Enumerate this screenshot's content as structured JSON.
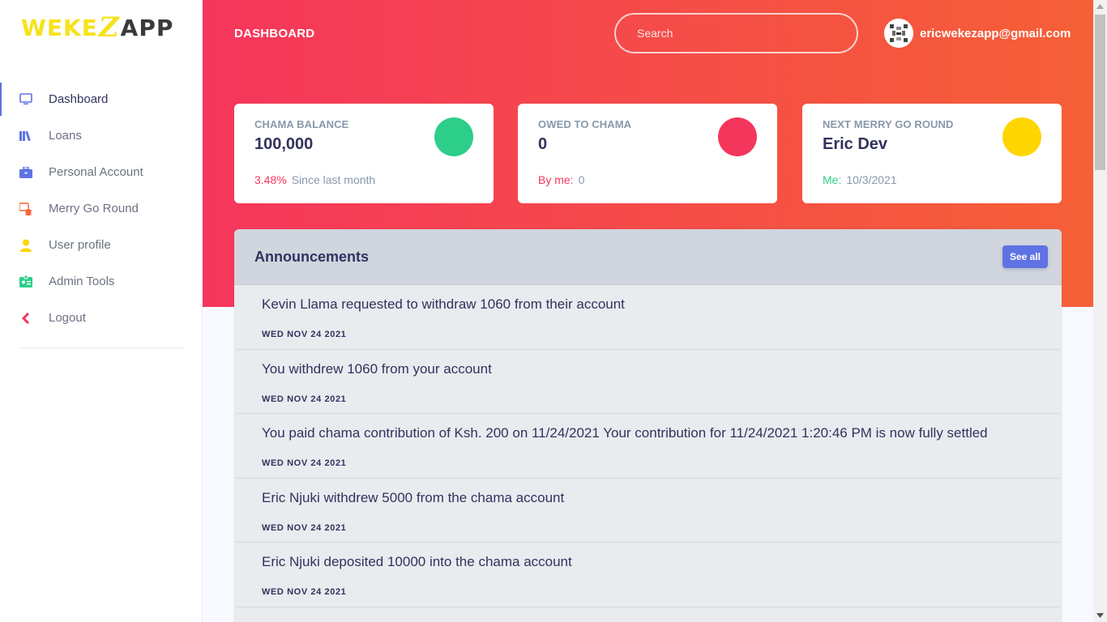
{
  "brand": {
    "part1": "WEKE",
    "part2": "Z",
    "part3": "APP"
  },
  "header": {
    "title": "DASHBOARD",
    "search_placeholder": "Search",
    "user_email": "ericwekezapp@gmail.com"
  },
  "sidebar": {
    "items": [
      {
        "label": "Dashboard",
        "icon": "monitor-icon",
        "active": true
      },
      {
        "label": "Loans",
        "icon": "books-icon"
      },
      {
        "label": "Personal Account",
        "icon": "briefcase-icon"
      },
      {
        "label": "Merry Go Round",
        "icon": "coins-icon"
      },
      {
        "label": "User profile",
        "icon": "user-icon"
      },
      {
        "label": "Admin Tools",
        "icon": "badge-icon"
      },
      {
        "label": "Logout",
        "icon": "chevron-left-icon"
      }
    ]
  },
  "cards": [
    {
      "title": "CHAMA BALANCE",
      "value": "100,000",
      "foot_highlight": "3.48%",
      "foot_text": "Since last month",
      "color": "#2dce89",
      "highlight_color": "#f5365c"
    },
    {
      "title": "OWED TO CHAMA",
      "value": "0",
      "foot_highlight": "By me:",
      "foot_text": "0",
      "color": "#f5365c",
      "highlight_color": "#f5365c"
    },
    {
      "title": "NEXT MERRY GO ROUND",
      "value": "Eric Dev",
      "foot_highlight": "Me:",
      "foot_text": "10/3/2021",
      "color": "#ffd600",
      "highlight_color": "#2dce89"
    }
  ],
  "announcements": {
    "title": "Announcements",
    "see_all_label": "See all",
    "items": [
      {
        "text": "Kevin Llama requested to withdraw 1060 from their account",
        "date": "WED NOV 24 2021"
      },
      {
        "text": "You withdrew 1060 from your account",
        "date": "WED NOV 24 2021"
      },
      {
        "text": "You paid chama contribution of Ksh. 200 on 11/24/2021 Your contribution for 11/24/2021 1:20:46 PM is now fully settled",
        "date": "WED NOV 24 2021"
      },
      {
        "text": "Eric Njuki withdrew 5000 from the chama account",
        "date": "WED NOV 24 2021"
      },
      {
        "text": "Eric Njuki deposited 10000 into the chama account",
        "date": "WED NOV 24 2021"
      }
    ]
  },
  "colors": {
    "primary": "#5e72e4",
    "danger": "#f5365c",
    "success": "#2dce89",
    "warning": "#ffd600"
  }
}
